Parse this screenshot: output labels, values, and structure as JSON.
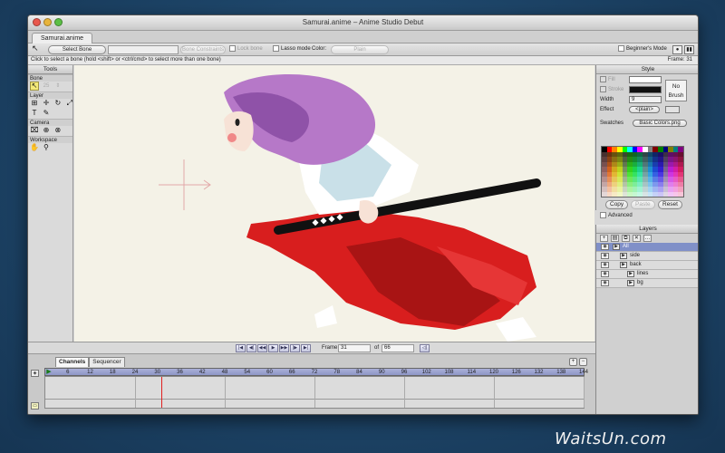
{
  "window": {
    "title": "Samurai.anime – Anime Studio Debut"
  },
  "document_tab": "Samurai.anime",
  "tool_options": {
    "select_bone": "Select Bone",
    "bone_constraints": "Bone Constraints",
    "lock_bone": "Lock bone",
    "lasso_mode": "Lasso mode",
    "color_label": "Color:",
    "color_value": "Plain",
    "beginners_mode": "Beginner's Mode"
  },
  "hint": "Click to select a bone (hold <shift> or <ctrl/cmd> to select more than one bone)",
  "frame_indicator": "Frame: 31",
  "tools_panel": {
    "title": "Tools",
    "sections": [
      "Bone",
      "Layer",
      "Camera",
      "Workspace"
    ],
    "bone_field_value": "25"
  },
  "style_panel": {
    "title": "Style",
    "fill_label": "Fill",
    "stroke_label": "Stroke",
    "width_label": "Width",
    "width_value": "9",
    "effect_label": "Effect",
    "effect_value": "<plain>",
    "no_brush": "No Brush",
    "swatches_label": "Swatches",
    "swatches_value": "Basic Colors.png",
    "copy": "Copy",
    "paste": "Paste",
    "reset": "Reset",
    "advanced": "Advanced"
  },
  "layers_panel": {
    "title": "Layers",
    "layers": [
      {
        "name": "All",
        "selected": true,
        "indent": 0
      },
      {
        "name": "side",
        "selected": false,
        "indent": 1
      },
      {
        "name": "back",
        "selected": false,
        "indent": 1
      },
      {
        "name": "lines",
        "selected": false,
        "indent": 2
      },
      {
        "name": "bg",
        "selected": false,
        "indent": 2
      }
    ]
  },
  "playback": {
    "frame_label": "Frame",
    "frame_value": "31",
    "of_label": "of",
    "total_frames": "66"
  },
  "timeline": {
    "tabs": [
      "Channels",
      "Sequencer"
    ],
    "ruler_labels": [
      "0",
      "6",
      "12",
      "18",
      "24",
      "30",
      "36",
      "42",
      "48",
      "54",
      "60",
      "66",
      "72",
      "78",
      "84",
      "90",
      "96",
      "102",
      "108",
      "114",
      "120",
      "126",
      "132",
      "138",
      "144"
    ],
    "current_frame": 31
  },
  "watermark": "WaitsUn.com",
  "colors": {
    "layer_selected": "#8090c8",
    "playhead": "#e02020",
    "hakama_red": "#d81e1e",
    "hair_purple": "#b678c8"
  }
}
